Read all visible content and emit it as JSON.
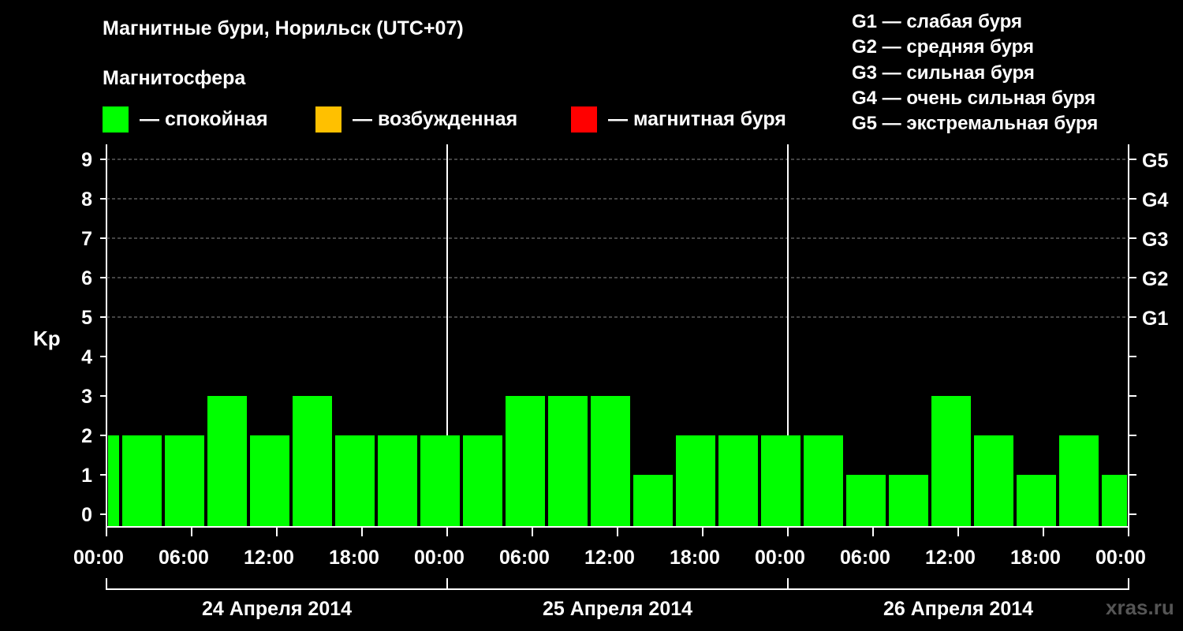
{
  "title": "Магнитные бури, Норильск (UTC+07)",
  "subtitle": "Магнитосфера",
  "legend": [
    {
      "label": "— спокойная",
      "color": "#00ff00"
    },
    {
      "label": "— возбужденная",
      "color": "#ffc000"
    },
    {
      "label": "— магнитная буря",
      "color": "#ff0000"
    }
  ],
  "g_scale": [
    "G1 — слабая буря",
    "G2 — средняя буря",
    "G3 — сильная буря",
    "G4 — очень сильная буря",
    "G5 — экстремальная буря"
  ],
  "watermark": "xras.ru",
  "chart_data": {
    "type": "bar",
    "ylabel": "Kp",
    "ylim": [
      0,
      9
    ],
    "yticks": [
      "0",
      "1",
      "2",
      "3",
      "4",
      "5",
      "6",
      "7",
      "8",
      "9"
    ],
    "right_ticks": [
      {
        "value": 5,
        "label": "G1"
      },
      {
        "value": 6,
        "label": "G2"
      },
      {
        "value": 7,
        "label": "G3"
      },
      {
        "value": 8,
        "label": "G4"
      },
      {
        "value": 9,
        "label": "G5"
      }
    ],
    "x_tick_labels": [
      "00:00",
      "06:00",
      "12:00",
      "18:00",
      "00:00",
      "06:00",
      "12:00",
      "18:00",
      "00:00",
      "06:00",
      "12:00",
      "18:00",
      "00:00"
    ],
    "days": [
      "24 Апреля 2014",
      "25 Апреля 2014",
      "26 Апреля 2014"
    ],
    "grid": "dashed horizontal lines at Kp 5–9",
    "bar_color": "#00ff00",
    "bars": [
      {
        "start": "00:00",
        "end": "01:00",
        "value": 2
      },
      {
        "start": "01:00",
        "end": "04:00",
        "value": 2
      },
      {
        "start": "04:00",
        "end": "07:00",
        "value": 2
      },
      {
        "start": "07:00",
        "end": "10:00",
        "value": 3
      },
      {
        "start": "10:00",
        "end": "13:00",
        "value": 2
      },
      {
        "start": "13:00",
        "end": "16:00",
        "value": 3
      },
      {
        "start": "16:00",
        "end": "19:00",
        "value": 2
      },
      {
        "start": "19:00",
        "end": "22:00",
        "value": 2
      },
      {
        "start": "22:00",
        "end": "01:00",
        "value": 2
      },
      {
        "start": "01:00",
        "end": "04:00",
        "value": 2
      },
      {
        "start": "04:00",
        "end": "07:00",
        "value": 3
      },
      {
        "start": "07:00",
        "end": "10:00",
        "value": 3
      },
      {
        "start": "10:00",
        "end": "13:00",
        "value": 3
      },
      {
        "start": "13:00",
        "end": "16:00",
        "value": 1
      },
      {
        "start": "16:00",
        "end": "19:00",
        "value": 2
      },
      {
        "start": "19:00",
        "end": "22:00",
        "value": 2
      },
      {
        "start": "22:00",
        "end": "01:00",
        "value": 2
      },
      {
        "start": "01:00",
        "end": "04:00",
        "value": 2
      },
      {
        "start": "04:00",
        "end": "07:00",
        "value": 1
      },
      {
        "start": "07:00",
        "end": "10:00",
        "value": 1
      },
      {
        "start": "10:00",
        "end": "13:00",
        "value": 3
      },
      {
        "start": "13:00",
        "end": "16:00",
        "value": 2
      },
      {
        "start": "16:00",
        "end": "19:00",
        "value": 1
      },
      {
        "start": "19:00",
        "end": "22:00",
        "value": 2
      },
      {
        "start": "22:00",
        "end": "00:00",
        "value": 1
      }
    ]
  }
}
